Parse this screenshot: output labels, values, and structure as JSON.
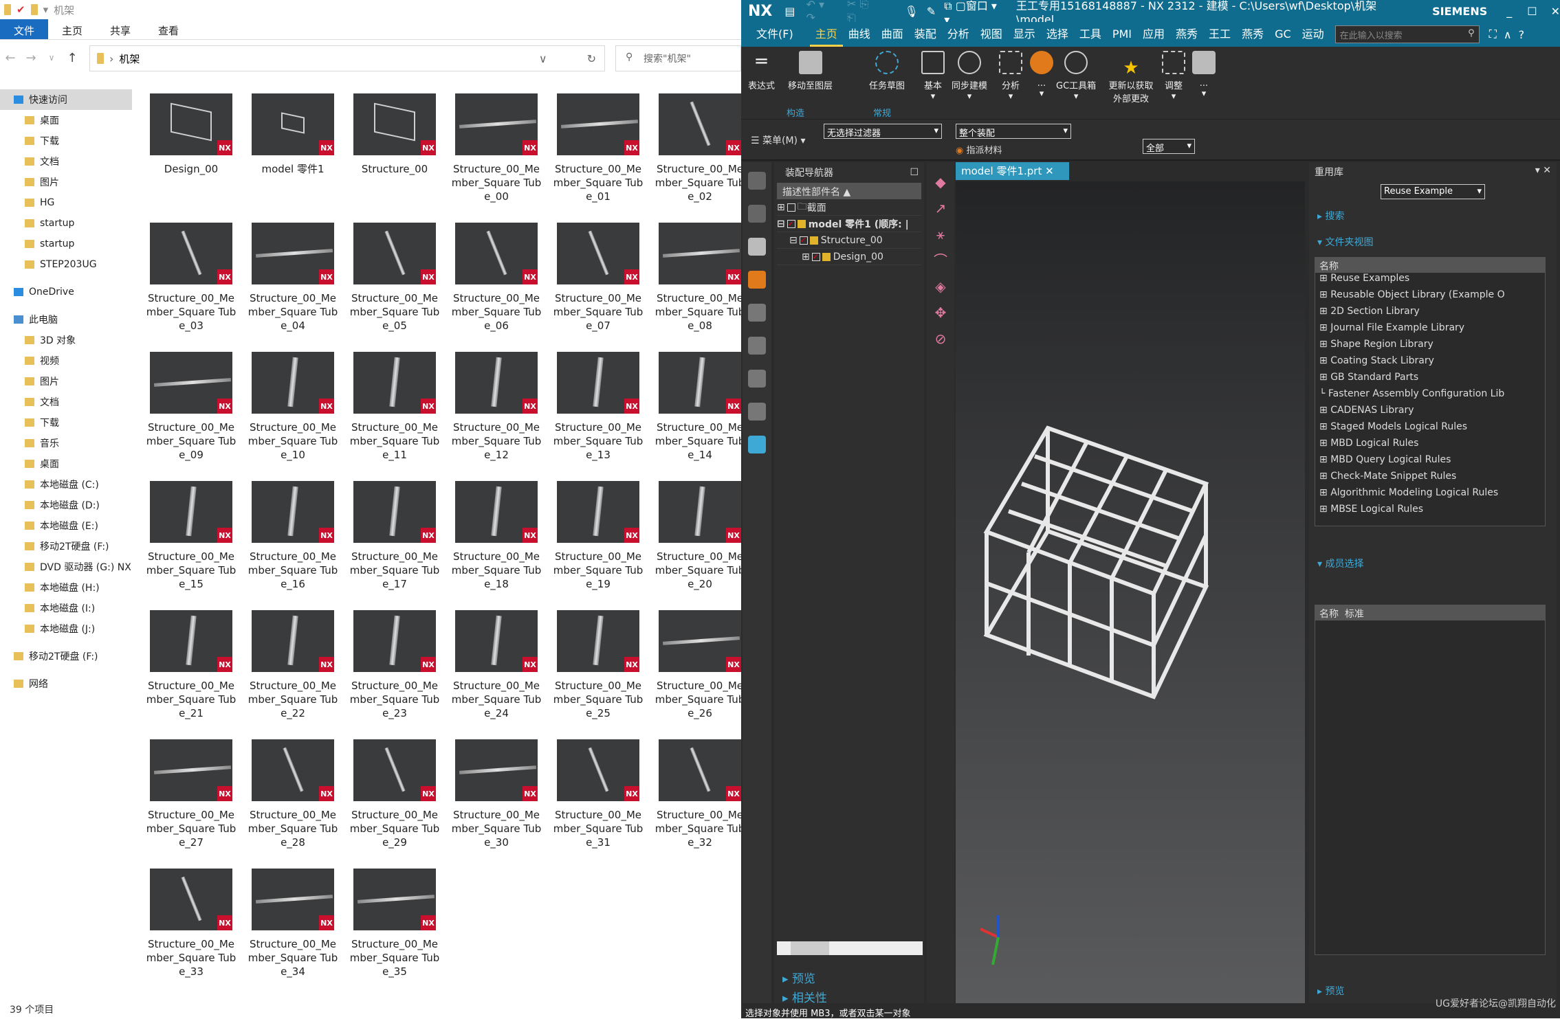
{
  "explorer": {
    "title": "机架",
    "ribbon_tabs": [
      "文件",
      "主页",
      "共享",
      "查看"
    ],
    "address": "机架",
    "search_placeholder": "搜索\"机架\"",
    "sidebar": [
      "快速访问",
      "桌面",
      "下载",
      "文档",
      "图片",
      "HG",
      "startup",
      "startup",
      "STEP203UG",
      "OneDrive",
      "此电脑",
      "3D 对象",
      "视频",
      "图片",
      "文档",
      "下载",
      "音乐",
      "桌面",
      "本地磁盘 (C:)",
      "本地磁盘 (D:)",
      "本地磁盘 (E:)",
      "移动2T硬盘 (F:)",
      "DVD 驱动器 (G:) NX",
      "本地磁盘 (H:)",
      "本地磁盘 (I:)",
      "本地磁盘 (J:)",
      "移动2T硬盘 (F:)",
      "网络"
    ],
    "badge": "NX",
    "files": [
      {
        "name": "Design_00",
        "thumb": "frame"
      },
      {
        "name": "model 零件1",
        "thumb": "small-frame"
      },
      {
        "name": "Structure_00",
        "thumb": "frame"
      },
      {
        "name": "Structure_00_Member_Square Tube_00",
        "thumb": "h"
      },
      {
        "name": "Structure_00_Member_Square Tube_01",
        "thumb": "h"
      },
      {
        "name": "Structure_00_Member_Square Tube_02",
        "thumb": "d"
      },
      {
        "name": "Structure_00_Member_Square Tube_03",
        "thumb": "d"
      },
      {
        "name": "Structure_00_Member_Square Tube_04",
        "thumb": "h"
      },
      {
        "name": "Structure_00_Member_Square Tube_05",
        "thumb": "d"
      },
      {
        "name": "Structure_00_Member_Square Tube_06",
        "thumb": "d"
      },
      {
        "name": "Structure_00_Member_Square Tube_07",
        "thumb": "d"
      },
      {
        "name": "Structure_00_Member_Square Tube_08",
        "thumb": "h"
      },
      {
        "name": "Structure_00_Member_Square Tube_09",
        "thumb": "h"
      },
      {
        "name": "Structure_00_Member_Square Tube_10",
        "thumb": "v"
      },
      {
        "name": "Structure_00_Member_Square Tube_11",
        "thumb": "v"
      },
      {
        "name": "Structure_00_Member_Square Tube_12",
        "thumb": "v"
      },
      {
        "name": "Structure_00_Member_Square Tube_13",
        "thumb": "v"
      },
      {
        "name": "Structure_00_Member_Square Tube_14",
        "thumb": "v"
      },
      {
        "name": "Structure_00_Member_Square Tube_15",
        "thumb": "v"
      },
      {
        "name": "Structure_00_Member_Square Tube_16",
        "thumb": "v"
      },
      {
        "name": "Structure_00_Member_Square Tube_17",
        "thumb": "v"
      },
      {
        "name": "Structure_00_Member_Square Tube_18",
        "thumb": "v"
      },
      {
        "name": "Structure_00_Member_Square Tube_19",
        "thumb": "v"
      },
      {
        "name": "Structure_00_Member_Square Tube_20",
        "thumb": "v"
      },
      {
        "name": "Structure_00_Member_Square Tube_21",
        "thumb": "v"
      },
      {
        "name": "Structure_00_Member_Square Tube_22",
        "thumb": "v"
      },
      {
        "name": "Structure_00_Member_Square Tube_23",
        "thumb": "v"
      },
      {
        "name": "Structure_00_Member_Square Tube_24",
        "thumb": "v"
      },
      {
        "name": "Structure_00_Member_Square Tube_25",
        "thumb": "v"
      },
      {
        "name": "Structure_00_Member_Square Tube_26",
        "thumb": "h"
      },
      {
        "name": "Structure_00_Member_Square Tube_27",
        "thumb": "h"
      },
      {
        "name": "Structure_00_Member_Square Tube_28",
        "thumb": "d"
      },
      {
        "name": "Structure_00_Member_Square Tube_29",
        "thumb": "d"
      },
      {
        "name": "Structure_00_Member_Square Tube_30",
        "thumb": "h"
      },
      {
        "name": "Structure_00_Member_Square Tube_31",
        "thumb": "d"
      },
      {
        "name": "Structure_00_Member_Square Tube_32",
        "thumb": "d"
      },
      {
        "name": "Structure_00_Member_Square Tube_33",
        "thumb": "d"
      },
      {
        "name": "Structure_00_Member_Square Tube_34",
        "thumb": "h"
      },
      {
        "name": "Structure_00_Member_Square Tube_35",
        "thumb": "h"
      }
    ],
    "status": "39 个项目"
  },
  "nx": {
    "logo": "NX",
    "quick_window": "窗口",
    "title": "王工专用15168148887 - NX 2312 - 建模 - C:\\Users\\wf\\Desktop\\机架\\model ...",
    "brand": "SIEMENS",
    "tabs": [
      "文件(F)",
      "主页",
      "曲线",
      "曲面",
      "装配",
      "分析",
      "视图",
      "显示",
      "选择",
      "工具",
      "PMI",
      "应用",
      "燕秀",
      "王工",
      "燕秀",
      "GC",
      "运动"
    ],
    "search_placeholder": "在此输入以搜索",
    "ribbon": {
      "buttons": [
        "表达式",
        "移动至图层",
        "任务草图",
        "基本",
        "同步建模",
        "分析",
        "...",
        "GC工具箱",
        "更新以获取外部更改",
        "调整",
        "..."
      ],
      "groups": [
        "构造",
        "常规"
      ]
    },
    "selection": {
      "menu": "菜单(M)",
      "filter": "无选择过滤器",
      "scope": "整个装配",
      "assign_material": "指派材料",
      "all": "全部"
    },
    "navigator": {
      "title": "装配导航器",
      "column": "描述性部件名",
      "rows": [
        "截面",
        "model  零件1  (顺序: |",
        "Structure_00",
        "Design_00"
      ],
      "preview": "预览",
      "dependency": "相关性"
    },
    "view_tab": "model  零件1.prt",
    "reuse": {
      "title": "重用库",
      "dropdown": "Reuse Example",
      "search": "搜索",
      "folder_view": "文件夹视图",
      "name_col": "名称",
      "items": [
        "Reuse Examples",
        "Reusable Object Library (Example O",
        "2D Section Library",
        "Journal File Example Library",
        "Shape Region Library",
        "Coating Stack Library",
        "GB Standard Parts",
        "Fastener Assembly Configuration Lib",
        "CADENAS Library",
        "Staged Models Logical Rules",
        "MBD Logical Rules",
        "MBD Query Logical Rules",
        "Check-Mate Snippet Rules",
        "Algorithmic Modeling Logical Rules",
        "MBSE Logical Rules"
      ],
      "member_select": "成员选择",
      "member_cols": [
        "名称",
        "标准"
      ],
      "preview": "预览"
    },
    "status": "选择对象并使用 MB3，或者双击某一对象",
    "watermark": "UG爱好者论坛@凯翔自动化",
    "colors": {
      "title_bar": "#0f6c8e",
      "accent": "#3fa9d6",
      "active_tab": "#ffd24a"
    }
  }
}
